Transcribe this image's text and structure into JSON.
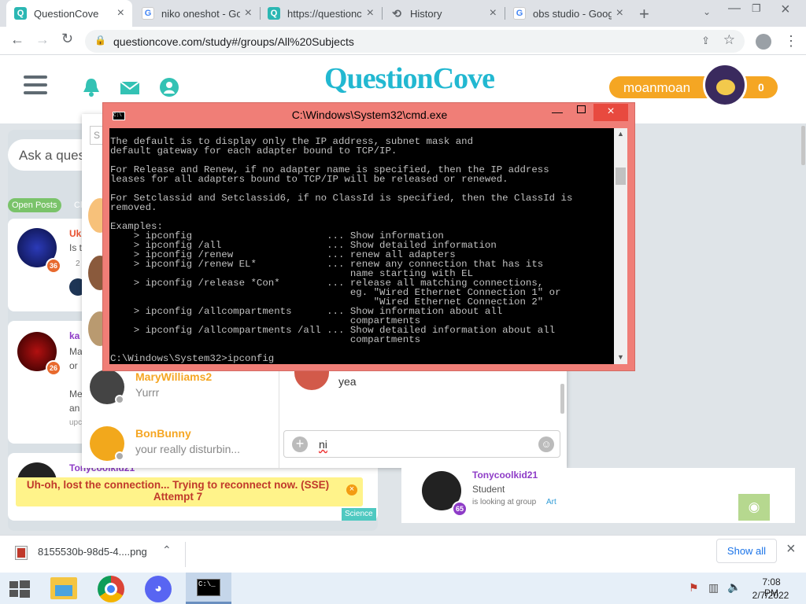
{
  "browser": {
    "tabs": [
      {
        "title": "QuestionCove",
        "active": true
      },
      {
        "title": "niko oneshot - Go",
        "active": false
      },
      {
        "title": "https://questionc",
        "active": false
      },
      {
        "title": "History",
        "active": false
      },
      {
        "title": "obs studio - Goog",
        "active": false
      }
    ],
    "url": "questioncove.com/study#/groups/All%20Subjects"
  },
  "site": {
    "logo": "QuestionCove",
    "username": "moanmoan",
    "user_points": "0",
    "ask_placeholder": "Ask a ques",
    "open_posts_label": "Open Posts",
    "more_label": "Cl",
    "posts": [
      {
        "name": "Uk",
        "snippet": "Is t",
        "level": "36",
        "replies": "2"
      },
      {
        "name": "ka",
        "snippet": "Ma or",
        "level": "26",
        "extra": "Me an",
        "footer": "upc"
      }
    ],
    "bottom_post_name": "Tonycoolkid21",
    "reconnect_message": "Uh-oh, lost the connection... Trying to reconnect now. (SSE) Attempt 7",
    "science_tag": "Science",
    "chat": {
      "search_placeholder": "S",
      "users": [
        {
          "name": "MaryWilliams2",
          "message": "Yurrr"
        },
        {
          "name": "BonBunny",
          "message": "your really disturbin..."
        }
      ],
      "last_message": "yea",
      "input_value": "ni"
    },
    "online_user": {
      "name": "Tonycoolkid21",
      "role": "Student",
      "activity_prefix": "is looking at group",
      "activity_group": "Art",
      "level": "65"
    }
  },
  "cmd": {
    "title": "C:\\Windows\\System32\\cmd.exe",
    "icon_label": "C:\\",
    "lines": [
      "The default is to display only the IP address, subnet mask and",
      "default gateway for each adapter bound to TCP/IP.",
      "",
      "For Release and Renew, if no adapter name is specified, then the IP address",
      "leases for all adapters bound to TCP/IP will be released or renewed.",
      "",
      "For Setclassid and Setclassid6, if no ClassId is specified, then the ClassId is",
      "removed.",
      "",
      "Examples:",
      "    > ipconfig                       ... Show information",
      "    > ipconfig /all                  ... Show detailed information",
      "    > ipconfig /renew                ... renew all adapters",
      "    > ipconfig /renew EL*            ... renew any connection that has its",
      "                                         name starting with EL",
      "    > ipconfig /release *Con*        ... release all matching connections,",
      "                                         eg. \"Wired Ethernet Connection 1\" or",
      "                                             \"Wired Ethernet Connection 2\"",
      "    > ipconfig /allcompartments      ... Show information about all",
      "                                         compartments",
      "    > ipconfig /allcompartments /all ... Show detailed information about all",
      "                                         compartments",
      "",
      "C:\\Windows\\System32>ipconfig"
    ]
  },
  "download": {
    "filename": "8155530b-98d5-4....png",
    "show_all": "Show all"
  },
  "taskbar": {
    "cmd_label": "C:\\_",
    "time": "7:08 PM",
    "date": "2/7/2022"
  },
  "colors": {
    "accent_orange": "#f5a623",
    "brand_teal": "#22b8d1",
    "cmd_titlebar": "#f07e77",
    "open_posts_green": "#7ac36a",
    "notify_yellow": "#fff38a"
  }
}
